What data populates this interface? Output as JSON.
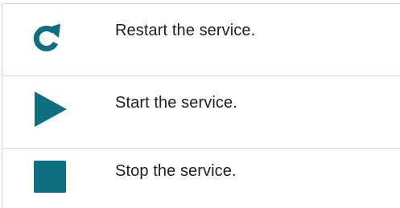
{
  "colors": {
    "icon": "#0f6f82",
    "border": "#d6d6d6",
    "text": "#1e1e1e"
  },
  "rows": [
    {
      "icon": "restart-icon",
      "description": "Restart the service."
    },
    {
      "icon": "play-icon",
      "description": "Start the service."
    },
    {
      "icon": "stop-icon",
      "description": "Stop the service."
    }
  ]
}
